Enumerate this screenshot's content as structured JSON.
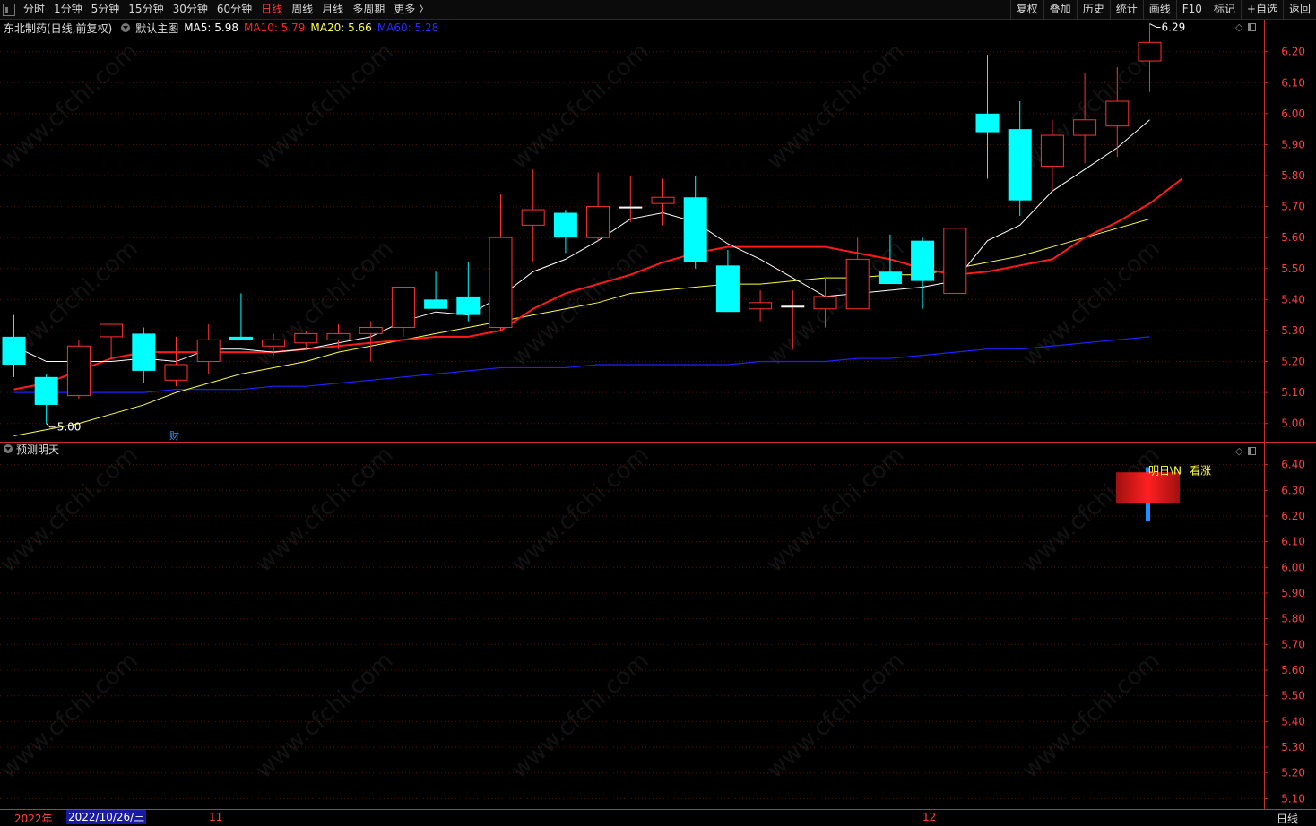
{
  "toolbar": {
    "periods": [
      "分时",
      "1分钟",
      "5分钟",
      "15分钟",
      "30分钟",
      "60分钟",
      "日线",
      "周线",
      "月线",
      "多周期",
      "更多 〉"
    ],
    "active_period": "日线",
    "right_buttons": [
      "复权",
      "叠加",
      "历史",
      "统计",
      "画线",
      "F10",
      "标记",
      "+自选",
      "返回"
    ]
  },
  "info": {
    "stock": "东北制药(日线,前复权)",
    "chart_mode": "默认主图",
    "ma": [
      {
        "label": "MA5: 5.98",
        "color": "#ffffff"
      },
      {
        "label": "MA10: 5.79",
        "color": "#ff2020"
      },
      {
        "label": "MA20: 5.66",
        "color": "#ffff40"
      },
      {
        "label": "MA60: 5.28",
        "color": "#2a2aff"
      }
    ]
  },
  "indicator": {
    "title": "预测明天",
    "label_a": "明日\\N",
    "label_b": "看涨",
    "bar_high": 6.37,
    "bar_low": 6.25,
    "wick_high": 6.39,
    "wick_low": 6.18
  },
  "bottom": {
    "year_label": "2022年",
    "date_label": "2022/10/26/三",
    "month_ticks": [
      "11",
      "12"
    ],
    "period_label": "日线"
  },
  "annotations": {
    "high_label": "6.29",
    "low_label": "5.00",
    "fin_marker": "财"
  },
  "watermark": "www.cfchi.com",
  "colors": {
    "up": "#ff3030",
    "down": "#00ffff",
    "ma5": "#ffffff",
    "ma10": "#ff1a1a",
    "ma20": "#ffff40",
    "ma60": "#2020ff",
    "axis": "#ff4040"
  },
  "chart_data": {
    "type": "candlestick",
    "title": "东北制药(日线,前复权)",
    "y_ticks_main": [
      "6.20",
      "6.10",
      "6.00",
      "5.90",
      "5.80",
      "5.70",
      "5.60",
      "5.50",
      "5.40",
      "5.30",
      "5.20",
      "5.10",
      "5.00"
    ],
    "y_ticks_sub": [
      "6.40",
      "6.30",
      "6.20",
      "6.10",
      "6.00",
      "5.90",
      "5.80",
      "5.70",
      "5.60",
      "5.50",
      "5.40",
      "5.30",
      "5.20",
      "5.10"
    ],
    "ylim_main": [
      4.95,
      6.28
    ],
    "ylim_sub": [
      5.07,
      6.43
    ],
    "candles": [
      {
        "o": 5.28,
        "h": 5.35,
        "l": 5.15,
        "c": 5.19
      },
      {
        "o": 5.15,
        "h": 5.16,
        "l": 5.0,
        "c": 5.06
      },
      {
        "o": 5.09,
        "h": 5.27,
        "l": 5.08,
        "c": 5.25
      },
      {
        "o": 5.28,
        "h": 5.32,
        "l": 5.21,
        "c": 5.32
      },
      {
        "o": 5.29,
        "h": 5.31,
        "l": 5.13,
        "c": 5.17
      },
      {
        "o": 5.14,
        "h": 5.28,
        "l": 5.12,
        "c": 5.19
      },
      {
        "o": 5.2,
        "h": 5.32,
        "l": 5.16,
        "c": 5.27
      },
      {
        "o": 5.28,
        "h": 5.42,
        "l": 5.27,
        "c": 5.27
      },
      {
        "o": 5.25,
        "h": 5.29,
        "l": 5.22,
        "c": 5.27
      },
      {
        "o": 5.26,
        "h": 5.3,
        "l": 5.24,
        "c": 5.29
      },
      {
        "o": 5.27,
        "h": 5.32,
        "l": 5.24,
        "c": 5.29
      },
      {
        "o": 5.29,
        "h": 5.33,
        "l": 5.2,
        "c": 5.31
      },
      {
        "o": 5.31,
        "h": 5.44,
        "l": 5.28,
        "c": 5.44
      },
      {
        "o": 5.4,
        "h": 5.49,
        "l": 5.37,
        "c": 5.37
      },
      {
        "o": 5.41,
        "h": 5.52,
        "l": 5.33,
        "c": 5.35
      },
      {
        "o": 5.31,
        "h": 5.74,
        "l": 5.3,
        "c": 5.6
      },
      {
        "o": 5.64,
        "h": 5.82,
        "l": 5.52,
        "c": 5.69
      },
      {
        "o": 5.68,
        "h": 5.69,
        "l": 5.55,
        "c": 5.6
      },
      {
        "o": 5.6,
        "h": 5.81,
        "l": 5.59,
        "c": 5.7
      },
      {
        "o": 5.7,
        "h": 5.8,
        "l": 5.65,
        "c": 5.7
      },
      {
        "o": 5.71,
        "h": 5.79,
        "l": 5.64,
        "c": 5.73
      },
      {
        "o": 5.73,
        "h": 5.8,
        "l": 5.5,
        "c": 5.52
      },
      {
        "o": 5.51,
        "h": 5.56,
        "l": 5.36,
        "c": 5.36
      },
      {
        "o": 5.37,
        "h": 5.43,
        "l": 5.33,
        "c": 5.39
      },
      {
        "o": 5.38,
        "h": 5.43,
        "l": 5.24,
        "c": 5.38
      },
      {
        "o": 5.37,
        "h": 5.47,
        "l": 5.31,
        "c": 5.41
      },
      {
        "o": 5.37,
        "h": 5.6,
        "l": 5.37,
        "c": 5.53
      },
      {
        "o": 5.49,
        "h": 5.61,
        "l": 5.46,
        "c": 5.45
      },
      {
        "o": 5.59,
        "h": 5.6,
        "l": 5.37,
        "c": 5.46
      },
      {
        "o": 5.42,
        "h": 5.63,
        "l": 5.42,
        "c": 5.63
      },
      {
        "o": 6.0,
        "h": 6.19,
        "l": 5.79,
        "c": 5.94
      },
      {
        "o": 5.95,
        "h": 6.04,
        "l": 5.67,
        "c": 5.72
      },
      {
        "o": 5.83,
        "h": 5.98,
        "l": 5.75,
        "c": 5.93
      },
      {
        "o": 5.93,
        "h": 6.13,
        "l": 5.84,
        "c": 5.98
      },
      {
        "o": 5.96,
        "h": 6.15,
        "l": 5.86,
        "c": 6.04
      },
      {
        "o": 6.17,
        "h": 6.29,
        "l": 6.07,
        "c": 6.23
      }
    ],
    "ma5": [
      5.25,
      5.2,
      5.2,
      5.2,
      5.21,
      5.2,
      5.24,
      5.24,
      5.23,
      5.24,
      5.26,
      5.28,
      5.33,
      5.36,
      5.35,
      5.41,
      5.49,
      5.53,
      5.59,
      5.66,
      5.68,
      5.65,
      5.58,
      5.53,
      5.47,
      5.41,
      5.42,
      5.43,
      5.44,
      5.46,
      5.59,
      5.64,
      5.75,
      5.82,
      5.89,
      5.98
    ],
    "ma10": [
      5.11,
      5.13,
      5.17,
      5.21,
      5.23,
      5.23,
      5.23,
      5.23,
      5.23,
      5.24,
      5.25,
      5.26,
      5.27,
      5.28,
      5.28,
      5.3,
      5.37,
      5.42,
      5.45,
      5.48,
      5.52,
      5.55,
      5.57,
      5.57,
      5.57,
      5.57,
      5.55,
      5.53,
      5.5,
      5.48,
      5.49,
      5.51,
      5.53,
      5.6,
      5.65,
      5.71,
      5.79
    ],
    "ma20": [
      4.96,
      4.98,
      5.0,
      5.03,
      5.06,
      5.1,
      5.13,
      5.16,
      5.18,
      5.2,
      5.23,
      5.25,
      5.27,
      5.29,
      5.31,
      5.33,
      5.35,
      5.37,
      5.39,
      5.42,
      5.43,
      5.44,
      5.45,
      5.45,
      5.46,
      5.47,
      5.47,
      5.48,
      5.48,
      5.5,
      5.52,
      5.54,
      5.57,
      5.6,
      5.63,
      5.66
    ],
    "ma60": [
      5.1,
      5.1,
      5.1,
      5.1,
      5.1,
      5.11,
      5.11,
      5.11,
      5.12,
      5.12,
      5.13,
      5.14,
      5.15,
      5.16,
      5.17,
      5.18,
      5.18,
      5.18,
      5.19,
      5.19,
      5.19,
      5.19,
      5.19,
      5.2,
      5.2,
      5.2,
      5.21,
      5.21,
      5.22,
      5.23,
      5.24,
      5.24,
      5.25,
      5.26,
      5.27,
      5.28
    ]
  }
}
